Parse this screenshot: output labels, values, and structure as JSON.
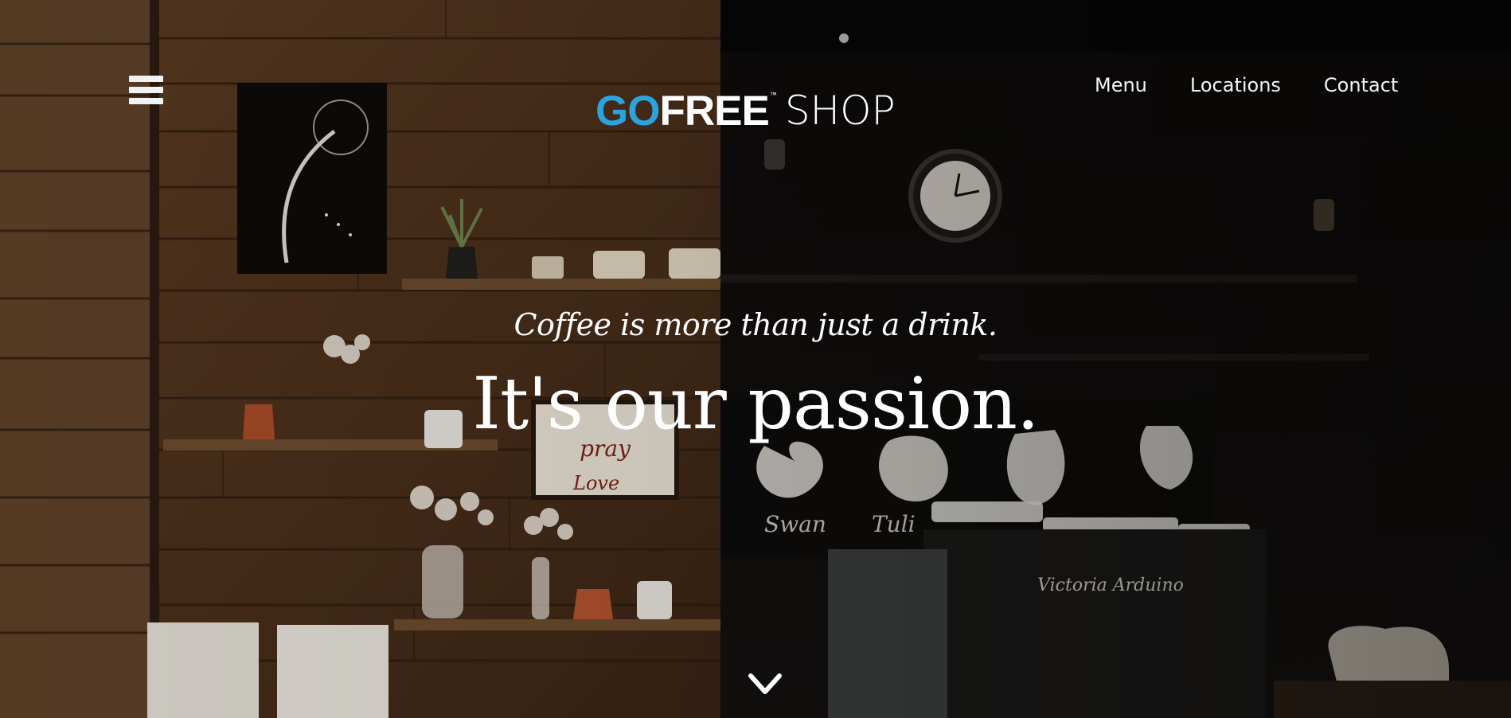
{
  "header": {
    "menu_toggle_icon": "hamburger-icon",
    "logo": {
      "part_go": "GO",
      "part_free": "FREE",
      "trademark": "™",
      "part_shop": "SHOP",
      "brand_color": "#2aa3df"
    },
    "nav_items": [
      {
        "label": "Menu"
      },
      {
        "label": "Locations"
      },
      {
        "label": "Contact"
      }
    ]
  },
  "hero": {
    "tagline": "Coffee is more than just a drink.",
    "headline": "It's our passion.",
    "scroll_icon": "chevron-down-icon"
  },
  "background": {
    "image": "coffee-shop-interior",
    "wall_text": [
      "pray",
      "Love",
      "Swan",
      "Tulip",
      "Victoria Arduino"
    ]
  }
}
